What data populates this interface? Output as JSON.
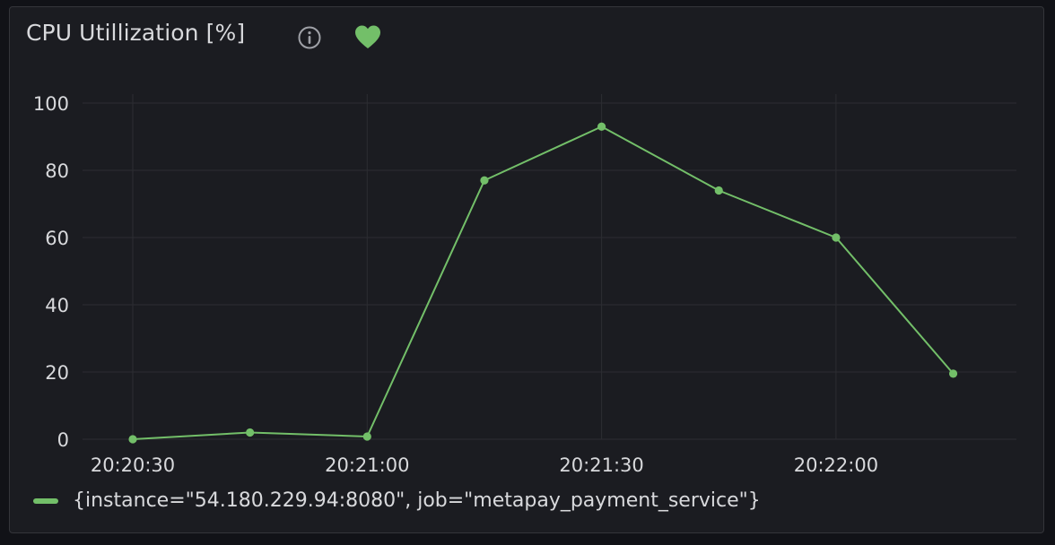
{
  "panel": {
    "title": "CPU Utillization [%]",
    "icons": [
      "info-icon",
      "heart-icon"
    ],
    "heart_color": "#73bf69"
  },
  "chart_data": {
    "type": "line",
    "title": "CPU Utillization [%]",
    "xlabel": "",
    "ylabel": "",
    "ylim": [
      0,
      100
    ],
    "y_ticks": [
      0,
      20,
      40,
      60,
      80,
      100
    ],
    "x_ticks": [
      "20:20:30",
      "20:21:00",
      "20:21:30",
      "20:22:00"
    ],
    "x": [
      "20:20:30",
      "20:20:45",
      "20:21:00",
      "20:21:15",
      "20:21:30",
      "20:21:45",
      "20:22:00",
      "20:22:15"
    ],
    "series": [
      {
        "name": "{instance=\"54.180.229.94:8080\", job=\"metapay_payment_service\"}",
        "color": "#73bf69",
        "values": [
          0,
          2,
          0.8,
          77,
          93,
          74,
          60,
          19.5
        ]
      }
    ],
    "grid": true,
    "legend": "bottom-left"
  }
}
